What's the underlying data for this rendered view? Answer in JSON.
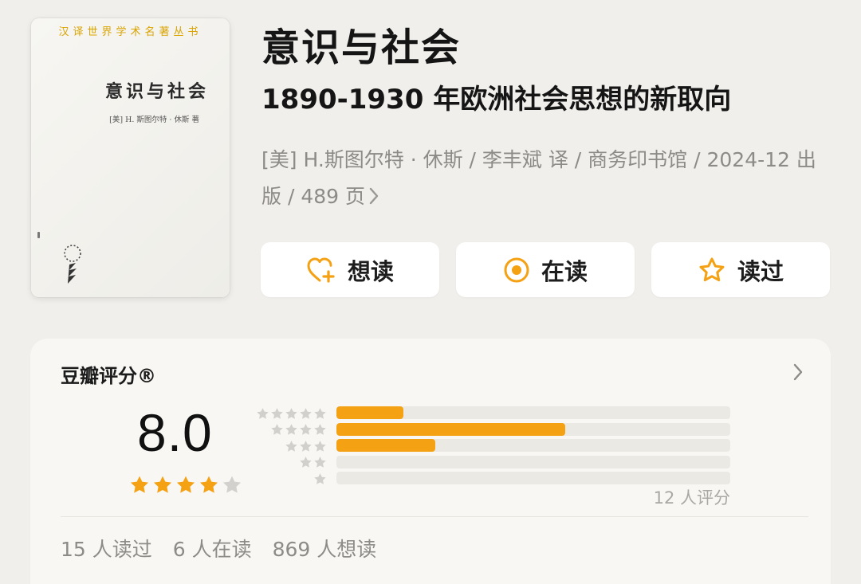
{
  "cover": {
    "series": "汉译世界学术名著丛书",
    "title": "意识与社会",
    "author": "[美] H. 斯图尔特 · 休斯 著"
  },
  "book": {
    "title": "意识与社会",
    "subtitle": "1890-1930 年欧洲社会思想的新取向",
    "meta": "[美] H.斯图尔特 · 休斯 / 李丰斌 译 / 商务印书馆 / 2024-12 出版 / 489 页"
  },
  "actions": [
    {
      "label": "想读",
      "icon": "heart-plus-icon"
    },
    {
      "label": "在读",
      "icon": "reading-circle-icon"
    },
    {
      "label": "读过",
      "icon": "star-outline-icon"
    }
  ],
  "rating": {
    "heading": "豆瓣评分®",
    "score": "8.0",
    "score_stars": 4,
    "distribution": [
      {
        "stars": 5,
        "fraction": 0.17
      },
      {
        "stars": 4,
        "fraction": 0.58
      },
      {
        "stars": 3,
        "fraction": 0.25
      },
      {
        "stars": 2,
        "fraction": 0.0
      },
      {
        "stars": 1,
        "fraction": 0.0
      }
    ],
    "count_text": "12 人评分"
  },
  "stats": {
    "read": "15 人读过",
    "reading": "6 人在读",
    "want": "869 人想读"
  },
  "colors": {
    "accent": "#f4a114",
    "background": "#f1efeb",
    "muted_text": "#8d8b88",
    "cover_series": "#d9a300"
  }
}
